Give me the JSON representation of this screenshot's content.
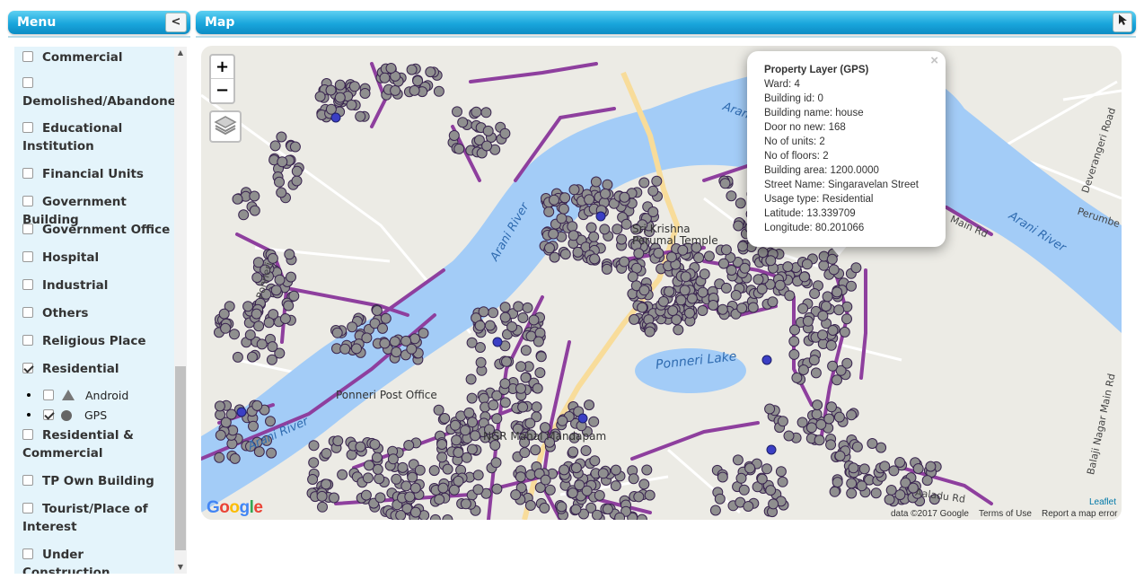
{
  "menu": {
    "title": "Menu",
    "collapse_label": "<"
  },
  "map_panel": {
    "title": "Map"
  },
  "categories": [
    {
      "label": "Commercial",
      "checked": false
    },
    {
      "label": "Demolished/Abandoned",
      "checked": false
    },
    {
      "label": "Educational Institution",
      "checked": false
    },
    {
      "label": "Financial Units",
      "checked": false
    },
    {
      "label": "Government Building",
      "checked": false
    },
    {
      "label": "Government Office",
      "checked": false
    },
    {
      "label": "Hospital",
      "checked": false
    },
    {
      "label": "Industrial",
      "checked": false
    },
    {
      "label": "Others",
      "checked": false
    },
    {
      "label": "Religious Place",
      "checked": false
    },
    {
      "label": "Residential",
      "checked": true
    },
    {
      "label": "Residential & Commercial",
      "checked": false
    },
    {
      "label": "TP Own Building",
      "checked": false
    },
    {
      "label": "Tourist/Place of Interest",
      "checked": false
    },
    {
      "label": "Under Construction",
      "checked": false
    }
  ],
  "residential_sublayers": [
    {
      "label": "Android",
      "checked": false,
      "icon": "triangle-icon"
    },
    {
      "label": "GPS",
      "checked": true,
      "icon": "circle-icon"
    }
  ],
  "map": {
    "zoom_in": "+",
    "zoom_out": "−",
    "labels": {
      "river_1": "Arani River",
      "river_2": "Arani River",
      "river_3": "Arani River",
      "river_4": "Arani R",
      "lake": "Ponneri Lake",
      "temple_1": "Sri Krishna",
      "temple_2": "Perumal Temple",
      "post_office": "Ponneri Post Office",
      "mandapam": "NGR Mahal Mandapam",
      "road_1": "Deverangeri Road",
      "road_2": "Perumbe",
      "road_3": "Balaji Nagar Main Rd",
      "road_4": "Aaladu Rd",
      "road_5": "Main Rd",
      "road_6": "Ponneri"
    },
    "popup": {
      "title": "Property Layer (GPS)",
      "lines": [
        "Ward: 4",
        "Building id: 0",
        "Building name: house",
        "Door no new: 168",
        "No of units: 2",
        "No of floors: 2",
        "Building area: 1200.0000",
        "Street Name: Singaravelan Street",
        "Usage type: Residential",
        "Latitude: 13.339709",
        "Longitude: 80.201066"
      ],
      "close": "×"
    },
    "attribution": {
      "google_logo": "Google",
      "map_data": "data ©2017 Google",
      "terms": "Terms of Use",
      "report": "Report a map error",
      "leaflet": "Leaflet"
    }
  },
  "colors": {
    "header_blue": "#1aa6dc",
    "river": "#a3ccf7",
    "road": "#8e3f9e",
    "marker_fill": "#8f8f8f",
    "marker_stroke": "#3a2550",
    "map_bg": "#ecebe5"
  }
}
